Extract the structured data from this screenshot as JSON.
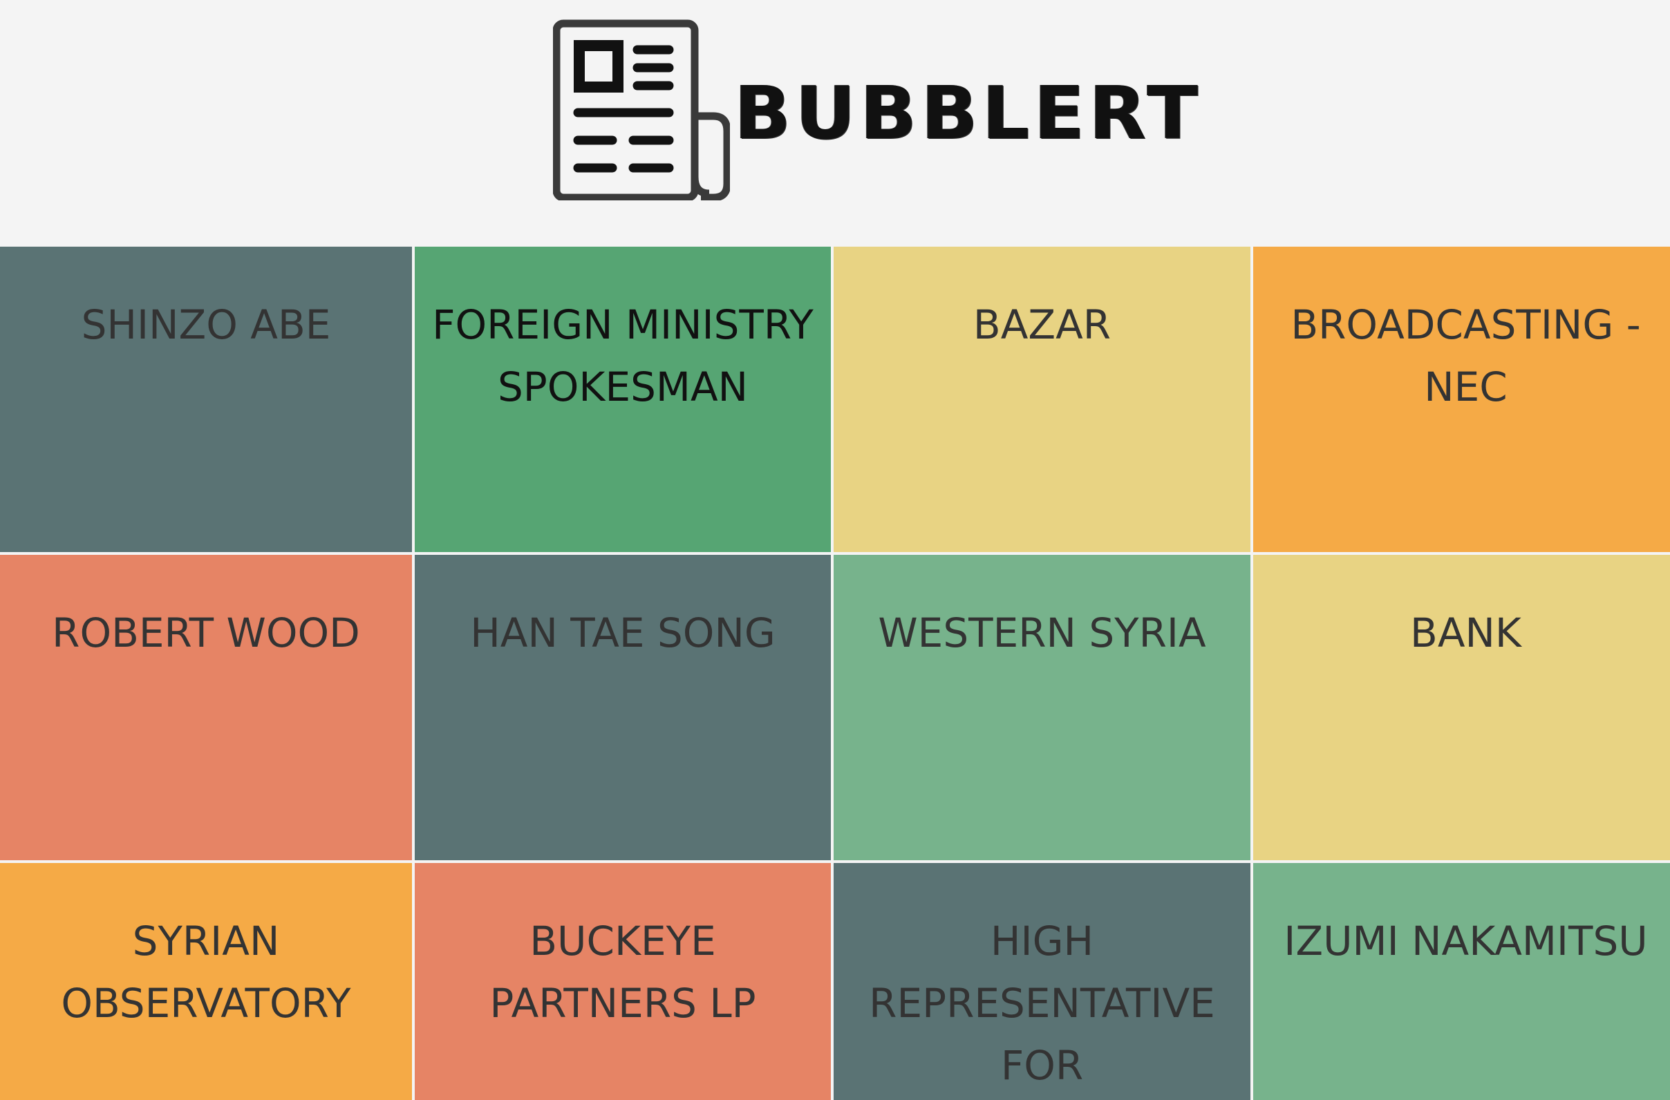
{
  "app": {
    "brand": "BUBBLERT",
    "logo_icon": "newspaper-icon"
  },
  "colors": {
    "slate": "#5a7374",
    "green": "#56a573",
    "sage": "#77b38c",
    "sand": "#e8d383",
    "orange": "#f5aa46",
    "coral": "#e68465"
  },
  "tiles": [
    {
      "label": "SHINZO ABE",
      "color": "#5a7374"
    },
    {
      "label": "FOREIGN MINISTRY SPOKESMAN",
      "color": "#56a573"
    },
    {
      "label": "BAZAR",
      "color": "#e8d383"
    },
    {
      "label": "BROADCASTING - NEC",
      "color": "#f5aa46"
    },
    {
      "label": "ROBERT WOOD",
      "color": "#e68465"
    },
    {
      "label": "HAN TAE SONG",
      "color": "#5a7374"
    },
    {
      "label": "WESTERN SYRIA",
      "color": "#77b38c"
    },
    {
      "label": "BANK",
      "color": "#e8d383"
    },
    {
      "label": "SYRIAN OBSERVATORY",
      "color": "#f5aa46"
    },
    {
      "label": "BUCKEYE PARTNERS LP",
      "color": "#e68465"
    },
    {
      "label": "HIGH REPRESENTATIVE FOR",
      "color": "#5a7374"
    },
    {
      "label": "IZUMI NAKAMITSU",
      "color": "#77b38c"
    }
  ]
}
